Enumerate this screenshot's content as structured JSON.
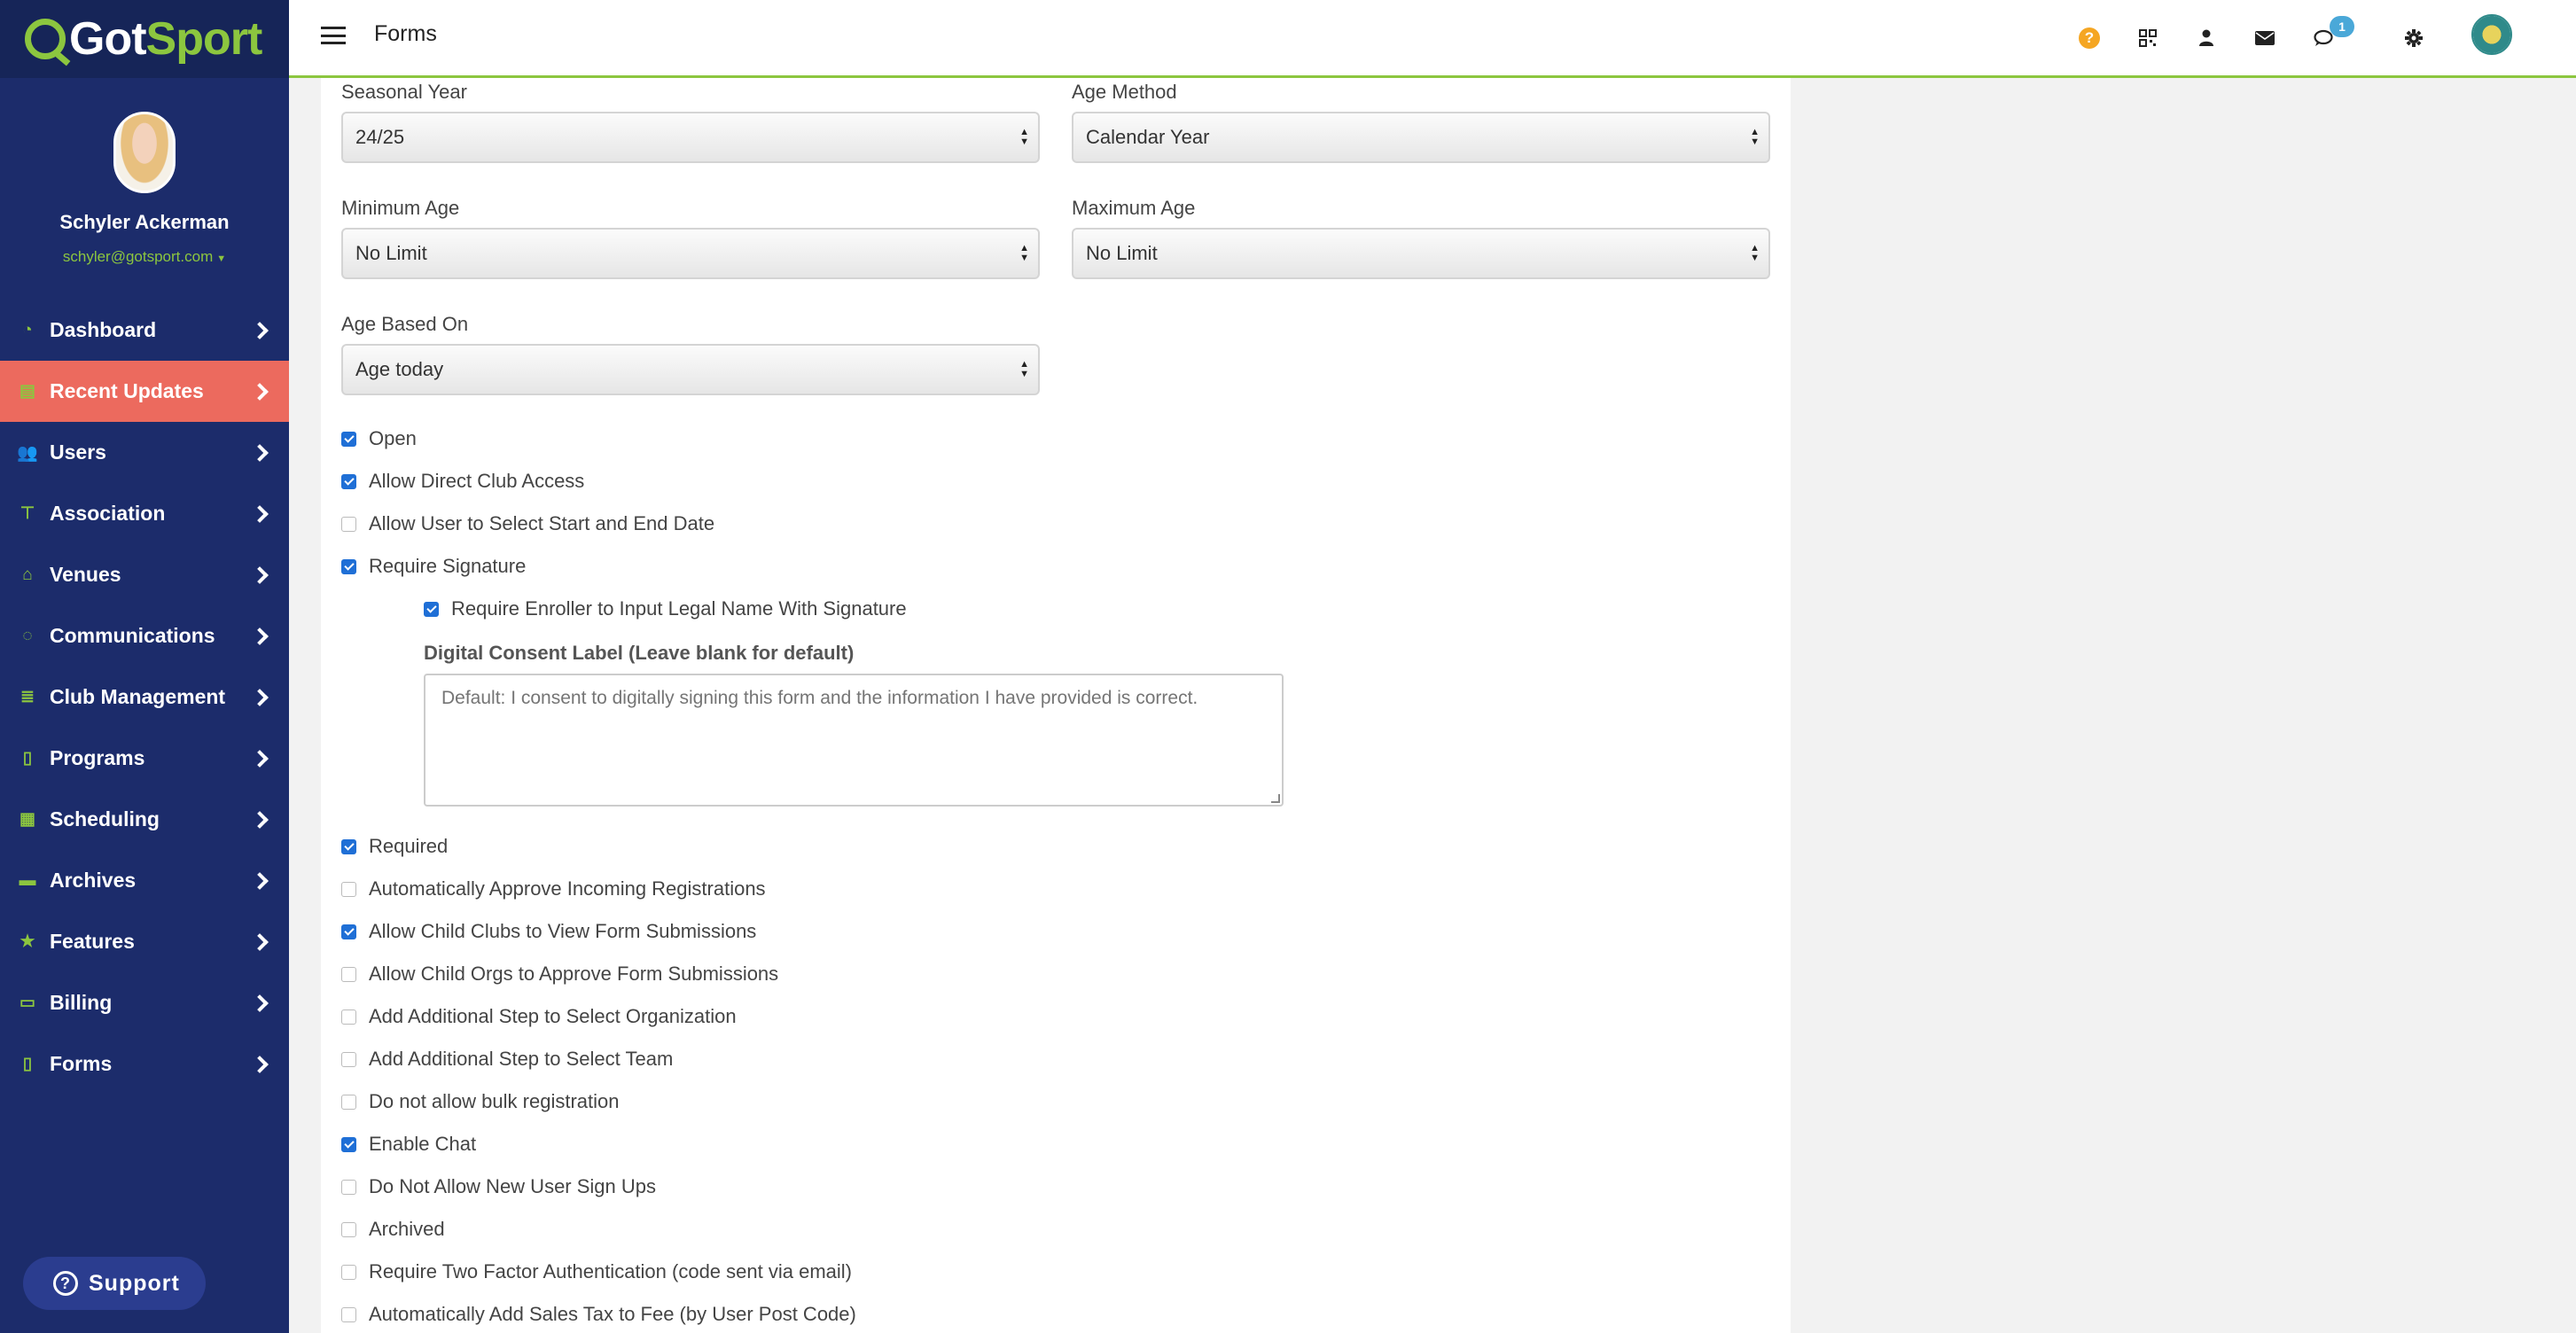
{
  "app": {
    "logo_prefix": "Got",
    "logo_suffix": "Sport",
    "page_title": "Forms"
  },
  "profile": {
    "name": "Schyler Ackerman",
    "email": "schyler@gotsport.com"
  },
  "nav": [
    {
      "label": "Dashboard",
      "icon": "dashboard-icon",
      "active": false
    },
    {
      "label": "Recent Updates",
      "icon": "recent-updates-icon",
      "active": true
    },
    {
      "label": "Users",
      "icon": "users-icon",
      "active": false
    },
    {
      "label": "Association",
      "icon": "association-icon",
      "active": false
    },
    {
      "label": "Venues",
      "icon": "venues-icon",
      "active": false
    },
    {
      "label": "Communications",
      "icon": "communications-icon",
      "active": false
    },
    {
      "label": "Club Management",
      "icon": "club-management-icon",
      "active": false
    },
    {
      "label": "Programs",
      "icon": "programs-icon",
      "active": false
    },
    {
      "label": "Scheduling",
      "icon": "scheduling-icon",
      "active": false
    },
    {
      "label": "Archives",
      "icon": "archives-icon",
      "active": false
    },
    {
      "label": "Features",
      "icon": "features-icon",
      "active": false
    },
    {
      "label": "Billing",
      "icon": "billing-icon",
      "active": false
    },
    {
      "label": "Forms",
      "icon": "forms-icon",
      "active": false
    }
  ],
  "support": {
    "label": "Support"
  },
  "topbar": {
    "messages_badge": "1"
  },
  "form": {
    "seasonal_year": {
      "label": "Seasonal Year",
      "value": "24/25"
    },
    "age_method": {
      "label": "Age Method",
      "value": "Calendar Year"
    },
    "minimum_age": {
      "label": "Minimum Age",
      "value": "No Limit"
    },
    "maximum_age": {
      "label": "Maximum Age",
      "value": "No Limit"
    },
    "age_based_on": {
      "label": "Age Based On",
      "value": "Age today"
    },
    "checks_top": [
      {
        "label": "Open",
        "checked": true
      },
      {
        "label": "Allow Direct Club Access",
        "checked": true
      },
      {
        "label": "Allow User to Select Start and End Date",
        "checked": false
      },
      {
        "label": "Require Signature",
        "checked": true
      }
    ],
    "require_legal_name": {
      "label": "Require Enroller to Input Legal Name With Signature",
      "checked": true
    },
    "consent": {
      "label": "Digital Consent Label (Leave blank for default)",
      "placeholder": "Default: I consent to digitally signing this form and the information I have provided is correct."
    },
    "checks_bottom": [
      {
        "label": "Required",
        "checked": true
      },
      {
        "label": "Automatically Approve Incoming Registrations",
        "checked": false
      },
      {
        "label": "Allow Child Clubs to View Form Submissions",
        "checked": true
      },
      {
        "label": "Allow Child Orgs to Approve Form Submissions",
        "checked": false
      },
      {
        "label": "Add Additional Step to Select Organization",
        "checked": false
      },
      {
        "label": "Add Additional Step to Select Team",
        "checked": false
      },
      {
        "label": "Do not allow bulk registration",
        "checked": false
      },
      {
        "label": "Enable Chat",
        "checked": true
      },
      {
        "label": "Do Not Allow New User Sign Ups",
        "checked": false
      },
      {
        "label": "Archived",
        "checked": false
      },
      {
        "label": "Require Two Factor Authentication (code sent via email)",
        "checked": false
      },
      {
        "label": "Automatically Add Sales Tax to Fee (by User Post Code)",
        "checked": false
      }
    ]
  },
  "colors": {
    "sidebar": "#1c2c6b",
    "active": "#ec6a5e",
    "accent": "#8cc63f",
    "checkbox": "#1f6fd6"
  }
}
